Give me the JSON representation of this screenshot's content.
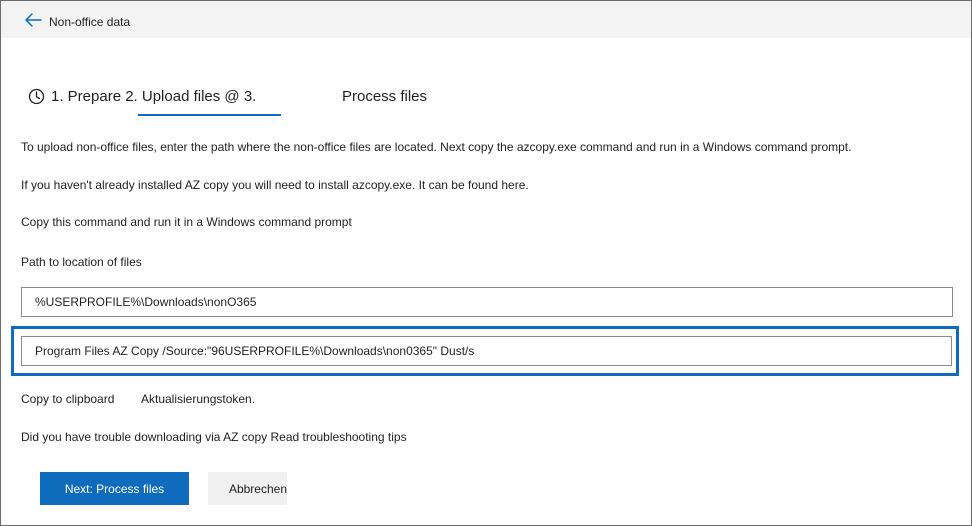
{
  "header": {
    "title": "Non-office data",
    "back_icon": "arrow-left-icon"
  },
  "steps": {
    "icon": "clock-icon",
    "current_label": "1. Prepare 2. Upload files @ 3.",
    "next_label": "Process files"
  },
  "instructions": {
    "line1": "To upload non-office files, enter the path where the non-office files are located. Next copy the azcopy.exe command and run in a Windows command prompt.",
    "line2": "If you haven't already installed AZ copy you will need to install azcopy.exe. It can be found here.",
    "line3": "Copy this command and run it in a Windows command prompt"
  },
  "path_field": {
    "label": "Path to location of files",
    "value": "%USERPROFILE%\\Downloads\\nonO365"
  },
  "command_field": {
    "value": "Program Files AZ Copy /Source:\"96USERPROFILE%\\Downloads\\non0365\" Dust/s"
  },
  "links": {
    "copy_clipboard": "Copy to clipboard",
    "refresh_token": "Aktualisierungstoken."
  },
  "troubleshoot": {
    "text": "Did you have trouble downloading via AZ copy Read troubleshooting tips"
  },
  "buttons": {
    "next_label": "Next: Process files",
    "cancel_label": "Abbrechen"
  },
  "colors": {
    "accent": "#0f6cbd",
    "header_bg": "#f3f3f3"
  }
}
